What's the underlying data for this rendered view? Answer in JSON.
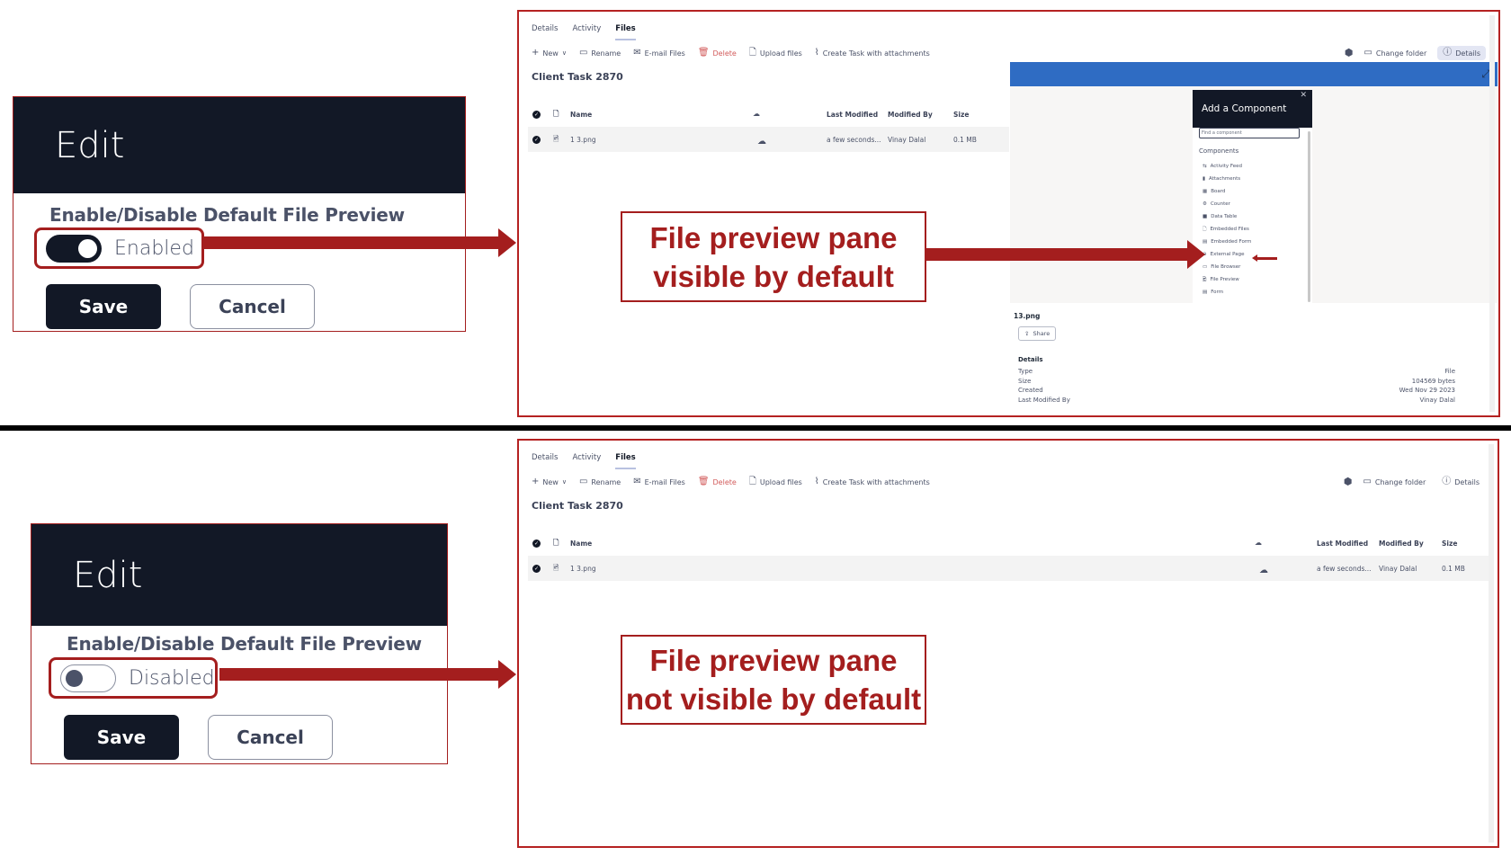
{
  "top": {
    "edit_panel": {
      "title": "Edit",
      "setting_label": "Enable/Disable Default File Preview",
      "toggle_state": "on",
      "toggle_text": "Enabled",
      "save_label": "Save",
      "cancel_label": "Cancel"
    },
    "callout": {
      "line1": "File preview pane",
      "line2": "visible by default"
    }
  },
  "bottom": {
    "edit_panel": {
      "title": "Edit",
      "setting_label": "Enable/Disable Default File Preview",
      "toggle_state": "off",
      "toggle_text": "Disabled",
      "save_label": "Save",
      "cancel_label": "Cancel"
    },
    "callout": {
      "line1": "File preview pane",
      "line2": "not visible by default"
    }
  },
  "app": {
    "tabs": [
      {
        "label": "Details",
        "active": false
      },
      {
        "label": "Activity",
        "active": false
      },
      {
        "label": "Files",
        "active": true
      }
    ],
    "toolbar": {
      "new": "New",
      "rename": "Rename",
      "email": "E-mail Files",
      "delete": "Delete",
      "upload": "Upload files",
      "create_task": "Create Task with attachments",
      "change_folder": "Change folder",
      "details": "Details"
    },
    "page_title": "Client Task 2870",
    "table": {
      "headers": {
        "name": "Name",
        "last_modified": "Last Modified",
        "modified_by": "Modified By",
        "size": "Size"
      },
      "rows": [
        {
          "name": "1 3.png",
          "last_modified": "a few seconds...",
          "modified_by": "Vinay Dalal",
          "size": "0.1 MB"
        }
      ]
    },
    "preview": {
      "dialog_title": "Add a Component",
      "search_placeholder": "Find a component",
      "section": "Components",
      "components": [
        "Activity Feed",
        "Attachments",
        "Board",
        "Counter",
        "Data Table",
        "Embedded Files",
        "Embedded Form",
        "External Page",
        "File Browser",
        "File Preview",
        "Form"
      ],
      "highlighted_component": "External Page",
      "file_name": "13.png",
      "share_label": "Share",
      "details_heading": "Details",
      "details": [
        {
          "key": "Type",
          "value": "File"
        },
        {
          "key": "Size",
          "value": "104569 bytes"
        },
        {
          "key": "Created",
          "value": "Wed Nov 29 2023"
        },
        {
          "key": "Last Modified By",
          "value": "Vinay Dalal"
        }
      ]
    }
  },
  "colors": {
    "annotation_red": "#a41e1e",
    "dark_navy": "#121826",
    "preview_blue": "#2f6cc3"
  }
}
